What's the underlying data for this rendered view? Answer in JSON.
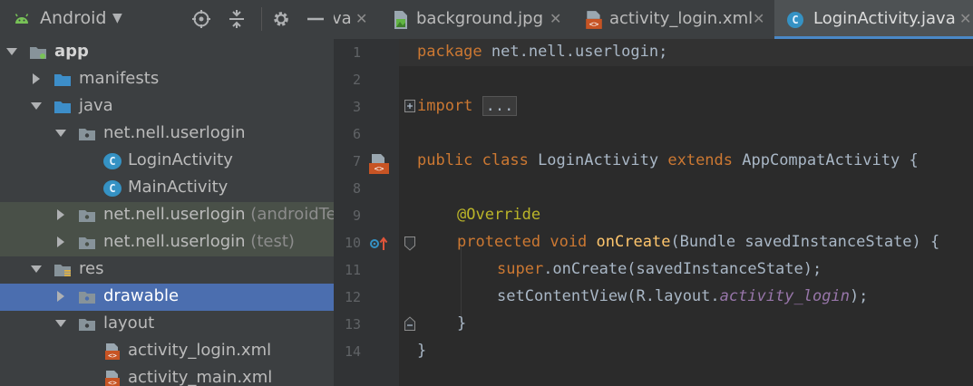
{
  "project_panel": {
    "title": "Android",
    "tree": [
      {
        "label": "app",
        "extra": "",
        "expanded": true,
        "icon": "module-folder-icon"
      },
      {
        "label": "manifests",
        "extra": "",
        "expanded": false,
        "icon": "folder-icon"
      },
      {
        "label": "java",
        "extra": "",
        "expanded": true,
        "icon": "folder-icon"
      },
      {
        "label": "net.nell.userlogin",
        "extra": "",
        "expanded": true,
        "icon": "package-icon"
      },
      {
        "label": "LoginActivity",
        "extra": "",
        "icon": "class-icon"
      },
      {
        "label": "MainActivity",
        "extra": "",
        "icon": "class-icon"
      },
      {
        "label": "net.nell.userlogin",
        "extra": " (androidTes",
        "expanded": false,
        "icon": "package-icon"
      },
      {
        "label": "net.nell.userlogin",
        "extra": " (test)",
        "expanded": false,
        "icon": "package-icon"
      },
      {
        "label": "res",
        "extra": "",
        "expanded": true,
        "icon": "res-folder-icon"
      },
      {
        "label": "drawable",
        "extra": "",
        "expanded": false,
        "icon": "package-icon",
        "selected": true
      },
      {
        "label": "layout",
        "extra": "",
        "expanded": true,
        "icon": "package-icon"
      },
      {
        "label": "activity_login.xml",
        "extra": "",
        "icon": "xml-file-icon"
      },
      {
        "label": "activity_main.xml",
        "extra": "",
        "icon": "xml-file-icon"
      }
    ]
  },
  "tabs": [
    {
      "label": "va",
      "icon": "",
      "active": false
    },
    {
      "label": "background.jpg",
      "icon": "image-file-icon",
      "active": false
    },
    {
      "label": "activity_login.xml",
      "icon": "xml-file-icon",
      "active": false
    },
    {
      "label": "LoginActivity.java",
      "icon": "class-icon",
      "active": true
    }
  ],
  "editor": {
    "line_numbers": [
      "1",
      "2",
      "3",
      "6",
      "7",
      "8",
      "9",
      "10",
      "11",
      "12",
      "13",
      "14"
    ],
    "code": {
      "l1_kw": "package",
      "l1_rest": " net.nell.userlogin;",
      "l3_kw": "import",
      "l3_fold": "...",
      "l7_kw1": "public class",
      "l7_name": " LoginActivity ",
      "l7_kw2": "extends",
      "l7_rest": " AppCompatActivity {",
      "l9_ann": "@Override",
      "l10_kw": "protected void",
      "l10_fn": "onCreate",
      "l10_rest": "(Bundle savedInstanceState) {",
      "l11_kw": "super",
      "l11_rest": ".onCreate(savedInstanceState);",
      "l12_pre": "setContentView(R.layout.",
      "l12_it": "activity_login",
      "l12_post": ");",
      "l13": "}",
      "l14": "}"
    }
  },
  "colors": {
    "keyword": "#cc7832",
    "annotation": "#bbb529",
    "method": "#ffc66d",
    "field": "#9876aa",
    "selection": "#4b6eaf"
  }
}
